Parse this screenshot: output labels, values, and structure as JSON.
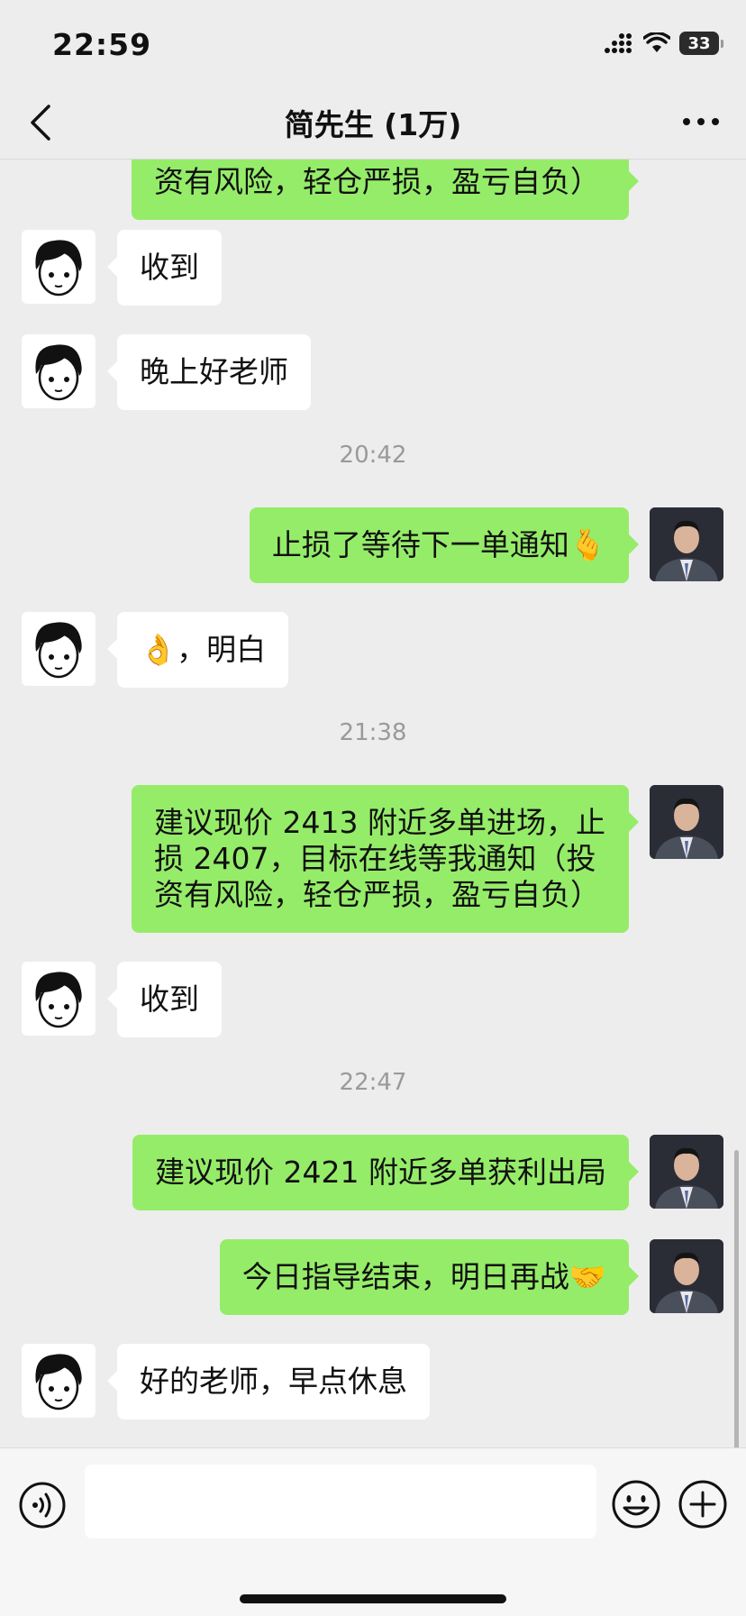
{
  "status_bar": {
    "time": "22:59",
    "battery": "33"
  },
  "header": {
    "title": "简先生 (1万)"
  },
  "messages": [
    {
      "type": "out",
      "text": "资有风险，轻仓严损，盈亏自负）"
    },
    {
      "type": "in",
      "text": "收到"
    },
    {
      "type": "in",
      "text": "晚上好老师"
    },
    {
      "type": "time",
      "text": "20:42"
    },
    {
      "type": "out",
      "text": "止损了等待下一单通知🫰"
    },
    {
      "type": "in",
      "text": "👌，明白"
    },
    {
      "type": "time",
      "text": "21:38"
    },
    {
      "type": "out",
      "lines": [
        "建议现价 2413 附近多单进场，止",
        "损 2407，目标在线等我通知（投",
        "资有风险，轻仓严损，盈亏自负）"
      ]
    },
    {
      "type": "in",
      "text": "收到"
    },
    {
      "type": "time",
      "text": "22:47"
    },
    {
      "type": "out",
      "text": "建议现价 2421 附近多单获利出局"
    },
    {
      "type": "out",
      "text": "今日指导结束，明日再战🤝"
    },
    {
      "type": "in",
      "text": "好的老师，早点休息"
    }
  ],
  "icons": {
    "back": "chevron-left-icon",
    "more": "more-icon",
    "voice": "voice-icon",
    "emoji": "emoji-icon",
    "plus": "plus-icon"
  },
  "colors": {
    "outgoing_bubble": "#95ec69",
    "incoming_bubble": "#ffffff",
    "background": "#ededed"
  }
}
